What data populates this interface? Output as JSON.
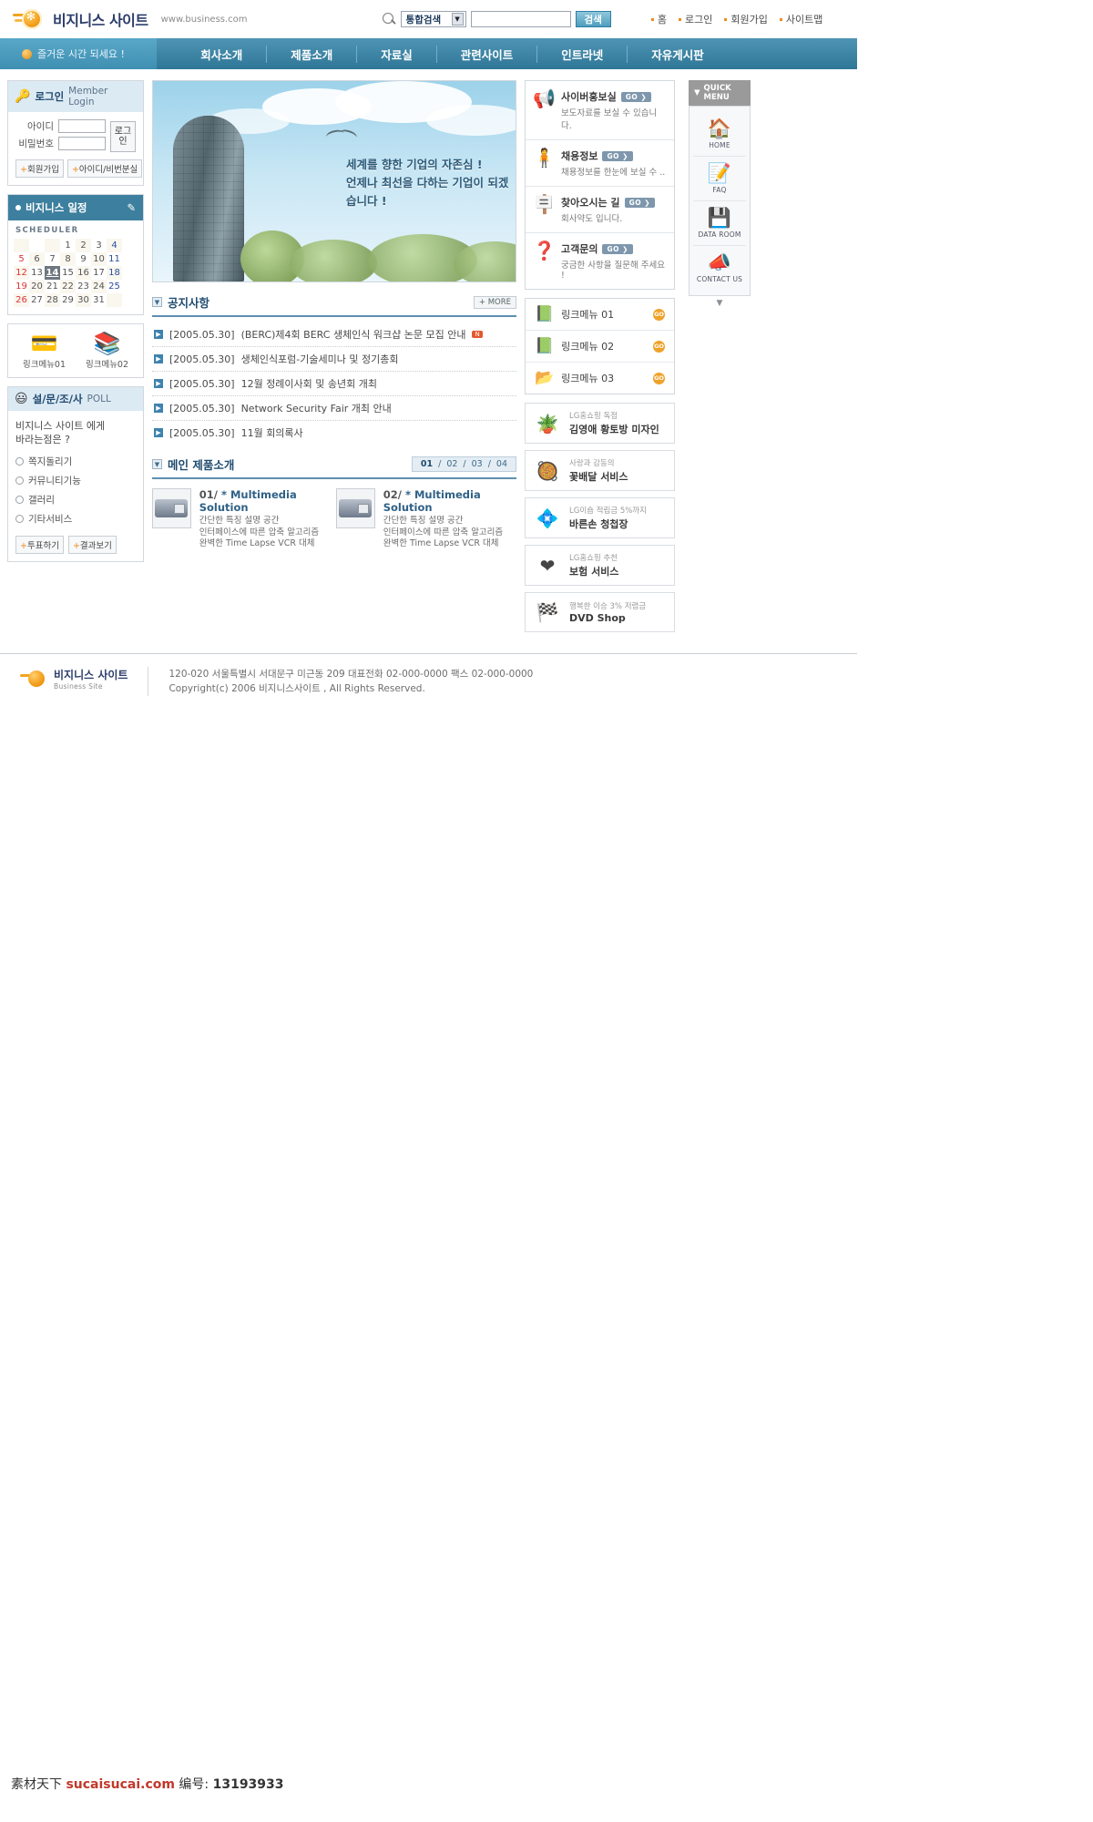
{
  "header": {
    "logo_text": "비지니스 사이트",
    "logo_url": "www.business.com",
    "search": {
      "category": "통합검색",
      "value": "",
      "placeholder": "",
      "button": "검색"
    },
    "util_links": [
      "홈",
      "로그인",
      "회원가입",
      "사이트맵"
    ]
  },
  "gnb": {
    "greeting": "즐거운 시간 되세요 !",
    "items": [
      "회사소개",
      "제품소개",
      "자료실",
      "관련사이트",
      "인트라넷",
      "자유게시판"
    ]
  },
  "login": {
    "title_ko": "로그인",
    "title_en": "Member Login",
    "id_label": "아이디",
    "pw_label": "비밀번호",
    "id_value": "",
    "pw_value": "",
    "submit": "로그인",
    "join": "회원가입",
    "find": "아이디/비번분실"
  },
  "scheduler": {
    "title": "비지니스 일정",
    "subtitle": "SCHEDULER",
    "today": 14,
    "weeks": [
      [
        "",
        "",
        "",
        "1",
        "2",
        "3",
        "4"
      ],
      [
        "5",
        "6",
        "7",
        "8",
        "9",
        "10",
        "11"
      ],
      [
        "12",
        "13",
        "14",
        "15",
        "16",
        "17",
        "18"
      ],
      [
        "19",
        "20",
        "21",
        "22",
        "23",
        "24",
        "25"
      ],
      [
        "26",
        "27",
        "28",
        "29",
        "30",
        "31",
        ""
      ]
    ]
  },
  "left_linkmenu": [
    {
      "label": "링크메뉴01",
      "icon": "card-icon"
    },
    {
      "label": "링크메뉴02",
      "icon": "books-icon"
    }
  ],
  "poll": {
    "title_ko": "설/문/조/사",
    "title_en": "POLL",
    "question": "비지니스 사이트 에게\n바라는점은 ?",
    "options": [
      "쪽지돌리기",
      "커뮤니티기능",
      "갤러리",
      "기타서비스"
    ],
    "vote_button": "투표하기",
    "result_button": "결과보기"
  },
  "visual": {
    "line1": "세계를 향한 기업의 자존심 !",
    "line2": "언제나 최선을 다하는 기업이 되겠습니다 !"
  },
  "notice": {
    "title": "공지사항",
    "more": "+ MORE",
    "items": [
      {
        "date": "[2005.05.30]",
        "text": "(BERC)제4회 BERC 생체인식 워크샵 논문 모집 안내",
        "new": "N"
      },
      {
        "date": "[2005.05.30]",
        "text": "생체인식포럼-기술세미나 및 정기총회",
        "new": ""
      },
      {
        "date": "[2005.05.30]",
        "text": "12월 정례이사회 및 송년회 개최",
        "new": ""
      },
      {
        "date": "[2005.05.30]",
        "text": "Network Security Fair 개최 안내",
        "new": ""
      },
      {
        "date": "[2005.05.30]",
        "text": "11월 회의록사",
        "new": ""
      }
    ]
  },
  "products": {
    "title": "메인 제품소개",
    "pages": [
      "01",
      "02",
      "03",
      "04"
    ],
    "active_page": "01",
    "items": [
      {
        "num": "01/",
        "title": "* Multimedia Solution",
        "desc1": "간단한 특징 설명 공간",
        "desc2": "인터페이스에 따른 압축 알고리즘",
        "desc3": "완벽한 Time Lapse VCR 대체"
      },
      {
        "num": "02/",
        "title": "* Multimedia Solution",
        "desc1": "간단한 특징 설명 공간",
        "desc2": "인터페이스에 따른 압축 알고리즘",
        "desc3": "완벽한 Time Lapse VCR 대체"
      }
    ]
  },
  "services": [
    {
      "icon": "megaphone-icon",
      "title": "사이버홍보실",
      "go": "GO ❯",
      "desc": "보도자료를 보실 수 있습니다."
    },
    {
      "icon": "person-icon",
      "title": "채용정보",
      "go": "GO ❯",
      "desc": "채용정보를 한눈에 보실 수 .."
    },
    {
      "icon": "signpost-icon",
      "title": "찾아오시는 길",
      "go": "GO ❯",
      "desc": "회사약도 입니다."
    },
    {
      "icon": "question-icon",
      "title": "고객문의",
      "go": "GO ❯",
      "desc": "궁금한 사항을 질문해 주세요 !"
    }
  ],
  "right_linkmenu": [
    {
      "icon": "book-icon",
      "label": "링크메뉴 01",
      "go": "GO"
    },
    {
      "icon": "book-icon",
      "label": "링크메뉴 02",
      "go": "GO"
    },
    {
      "icon": "folder-icon",
      "label": "링크메뉴 03",
      "go": "GO"
    }
  ],
  "banners": [
    {
      "icon": "hwangtobang-icon",
      "sub": "LG홈쇼핑 독점",
      "main": "김영애 황토방 미자인"
    },
    {
      "icon": "flower-cake-icon",
      "sub": "사랑과 감동의",
      "main": "꽃배달 서비스"
    },
    {
      "icon": "card-blue-icon",
      "sub": "LG이숍 적립금 5%까지",
      "main": "바른손 청첩장"
    },
    {
      "icon": "heart-icon",
      "sub": "LG홈쇼핑 추천",
      "main": "보험 서비스"
    },
    {
      "icon": "dvd-icon",
      "sub": "행복한 이승 3% 저렴금",
      "main": "DVD Shop"
    }
  ],
  "quick_menu": {
    "title": "QUICK MENU",
    "items": [
      {
        "icon": "home-icon",
        "label": "HOME"
      },
      {
        "icon": "faq-icon",
        "label": "FAQ"
      },
      {
        "icon": "floppy-icon",
        "label": "DATA ROOM"
      },
      {
        "icon": "contact-icon",
        "label": "CONTACT US"
      }
    ],
    "collapse": "▼"
  },
  "footer": {
    "name": "비지니스 사이트",
    "name_en": "Business Site",
    "address": "120-020 서울특별시 서대문구 미근동 209 대표전화  02-000-0000    팩스 02-000-0000",
    "copyright": "Copyright(c) 2006 비지니스사이트 ,  All Rights Reserved."
  },
  "credit": {
    "prefix": "素材天下",
    "site": "sucaisucai.com",
    "label": "编号:",
    "number": "13193933"
  }
}
